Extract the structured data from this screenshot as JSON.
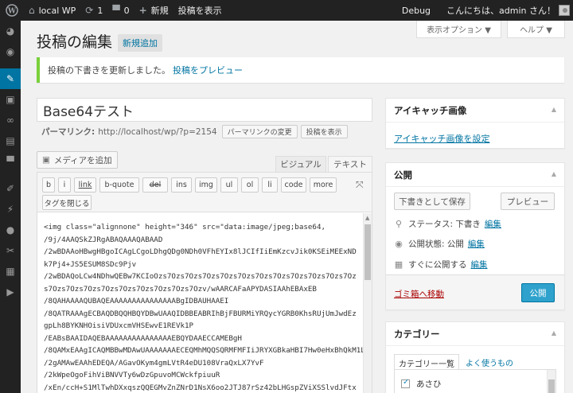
{
  "adminbar": {
    "site_name": "local WP",
    "updates_count": "1",
    "comments_count": "0",
    "new_label": "新規",
    "view_post_label": "投稿を表示",
    "debug_label": "Debug",
    "greeting": "こんにちは、admin さん！"
  },
  "screen_meta": {
    "options_label": "表示オプション ▼",
    "help_label": "ヘルプ ▼"
  },
  "header": {
    "title": "投稿の編集",
    "add_new_label": "新規追加"
  },
  "notice": {
    "text": "投稿の下書きを更新しました。",
    "link_label": "投稿をプレビュー"
  },
  "post": {
    "title": "Base64テスト",
    "permalink_label": "パーマリンク:",
    "permalink_url": "http://localhost/wp/?p=2154",
    "change_permalink_label": "パーマリンクの変更",
    "view_post_label": "投稿を表示"
  },
  "editor": {
    "media_button_label": "メディアを追加",
    "tab_visual": "ビジュアル",
    "tab_text": "テキスト",
    "quicktags": [
      "b",
      "i",
      "link",
      "b-quote",
      "del",
      "ins",
      "img",
      "ul",
      "ol",
      "li",
      "code",
      "more"
    ],
    "close_tags_label": "タグを閉じる",
    "content_lines": [
      "<img class=\"alignnone\" height=\"346\" src=\"data:image/jpeg;base64,",
      "/9j/4AAQSkZJRgABAQAAAQABAAD",
      "/2wBDAAoHBwgHBgoICAgLCgoLDhgQDg0NDh0VFhEYIx8lJCIfIiEmKzcvJik0KSEiMEExNDk7Pj4+JS5ESUM8SDc9Pjv",
      "/2wBDAQoLCw4NDhwQEBw7KCIoOzs7Ozs7Ozs7Ozs7Ozs7Ozs7Ozs7Ozs7Ozs7Ozs7Ozs7Ozs7Ozs7Ozs7Ozs7Ozs7Ozs7Ozs7Ozs7Ozs7Ozv/wAARCAFaAPYDASIAAhEBAxEB",
      "/8QAHAAAAQUBAQEAAAAAAAAAAAAAAABgIDBAUHAAEI",
      "/8QATRAAAgECBAQDBQQHBQYDBwUAAQIDBBEABRIhBjFBURMiYRQycYGRB0KhsRUjUmJwdEzgpLh8BYKNHOisiVDUxcmVHSEwvE1REVk1P",
      "/EABsBAAIDAQEBAAAAAAAAAAAAAAAEBQYDAAECCAMEBgH",
      "/8QAMxEAAgICAQMBBwMDAwUAAAAAAAECEQMhMQQSQRMFMFIiJRYXGBkaHBI7Hw0eHxBhQkM1L",
      "/2gAMAwEAAhEDEQA/AGavOKym4gmLVtR4eDU108VraQxLX7YvF",
      "/2kWpeOgoFihViBNVVTy6wDzGpuvoMCWckfpiuuR",
      "/xEn/ccH+S1MlTwhDXxqszQQEGMvZnZNrD1NsX6oo2JTJ87rSz42bLHGspZViXSSlvdJFtx"
    ]
  },
  "sidebar": {
    "featured_image": {
      "title": "アイキャッチ画像",
      "set_link": "アイキャッチ画像を設定"
    },
    "publish": {
      "title": "公開",
      "save_draft_label": "下書きとして保存",
      "preview_label": "プレビュー",
      "status_label": "ステータス: 下書き",
      "status_edit": "編集",
      "visibility_label": "公開状態: 公開",
      "visibility_edit": "編集",
      "schedule_label": "すぐに公開する",
      "schedule_edit": "編集",
      "trash_label": "ゴミ箱へ移動",
      "publish_label": "公開"
    },
    "categories": {
      "title": "カテゴリー",
      "tab_all": "カテゴリー一覧",
      "tab_popular": "よく使うもの",
      "items": [
        {
          "label": "あさひ",
          "checked": true
        }
      ]
    }
  }
}
